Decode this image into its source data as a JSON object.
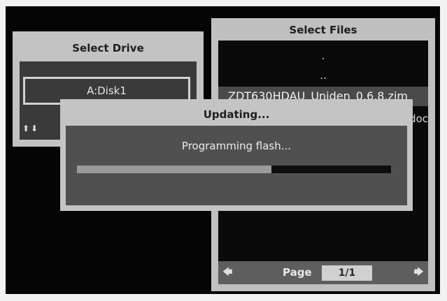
{
  "select_drive": {
    "title": "Select Drive",
    "items": [
      {
        "label": "A:Disk1",
        "selected": true
      }
    ],
    "nav_hint": "⬆⬇"
  },
  "select_files": {
    "title": "Select Files",
    "files": [
      {
        "label": ".",
        "selected": false
      },
      {
        "label": "..",
        "selected": false
      },
      {
        "label": "ZDT630HDAU_Uniden_0.6.8.zim",
        "selected": true
      },
      {
        "label": "doc",
        "selected": false
      }
    ],
    "footer": {
      "prev_icon": "arrow-left-icon",
      "next_icon": "arrow-right-icon",
      "page_label": "Page",
      "page_value": "1/1"
    }
  },
  "updating_dialog": {
    "title": "Updating...",
    "message": "Programming flash...",
    "progress": 0.62
  },
  "colors": {
    "screen_bg": "#050505",
    "panel_bg": "#c0c0c0",
    "progress_fill": "#9b9b9b",
    "progress_track": "#0e0e0e"
  }
}
